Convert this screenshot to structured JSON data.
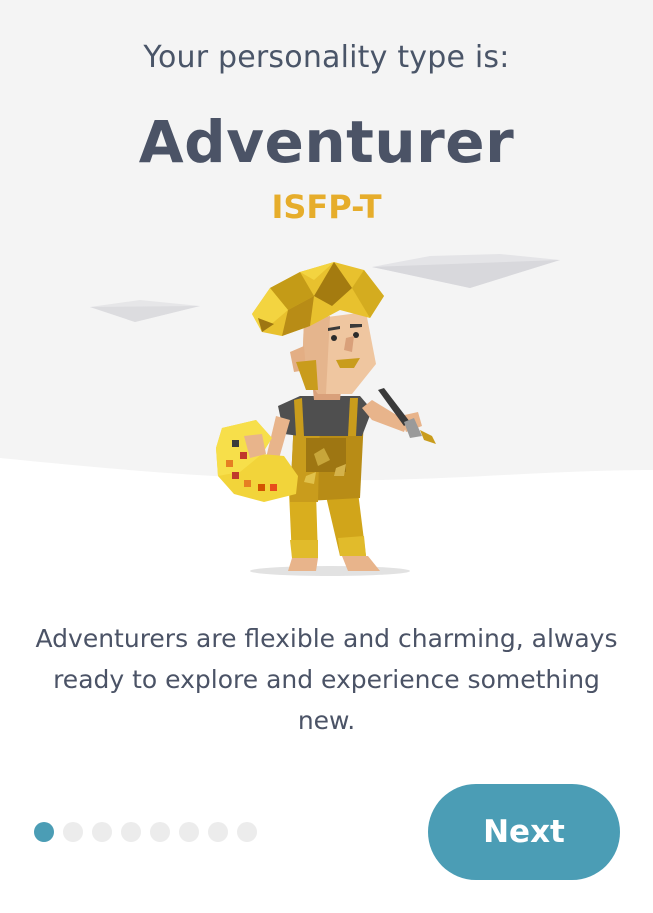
{
  "header": {
    "intro_text": "Your personality type is:",
    "type_name": "Adventurer",
    "type_code": "ISFP-T"
  },
  "description": "Adventurers are flexible and charming, always ready to explore and experience something new.",
  "pagination": {
    "total_pages": 8,
    "current_page": 1
  },
  "actions": {
    "next_label": "Next"
  },
  "colors": {
    "accent": "#4b9db5",
    "type_code": "#e6ad2b",
    "heading": "#4b5366",
    "background_top": "#f5f5f5"
  },
  "illustration": {
    "icon": "adventurer-painter-illustration"
  }
}
